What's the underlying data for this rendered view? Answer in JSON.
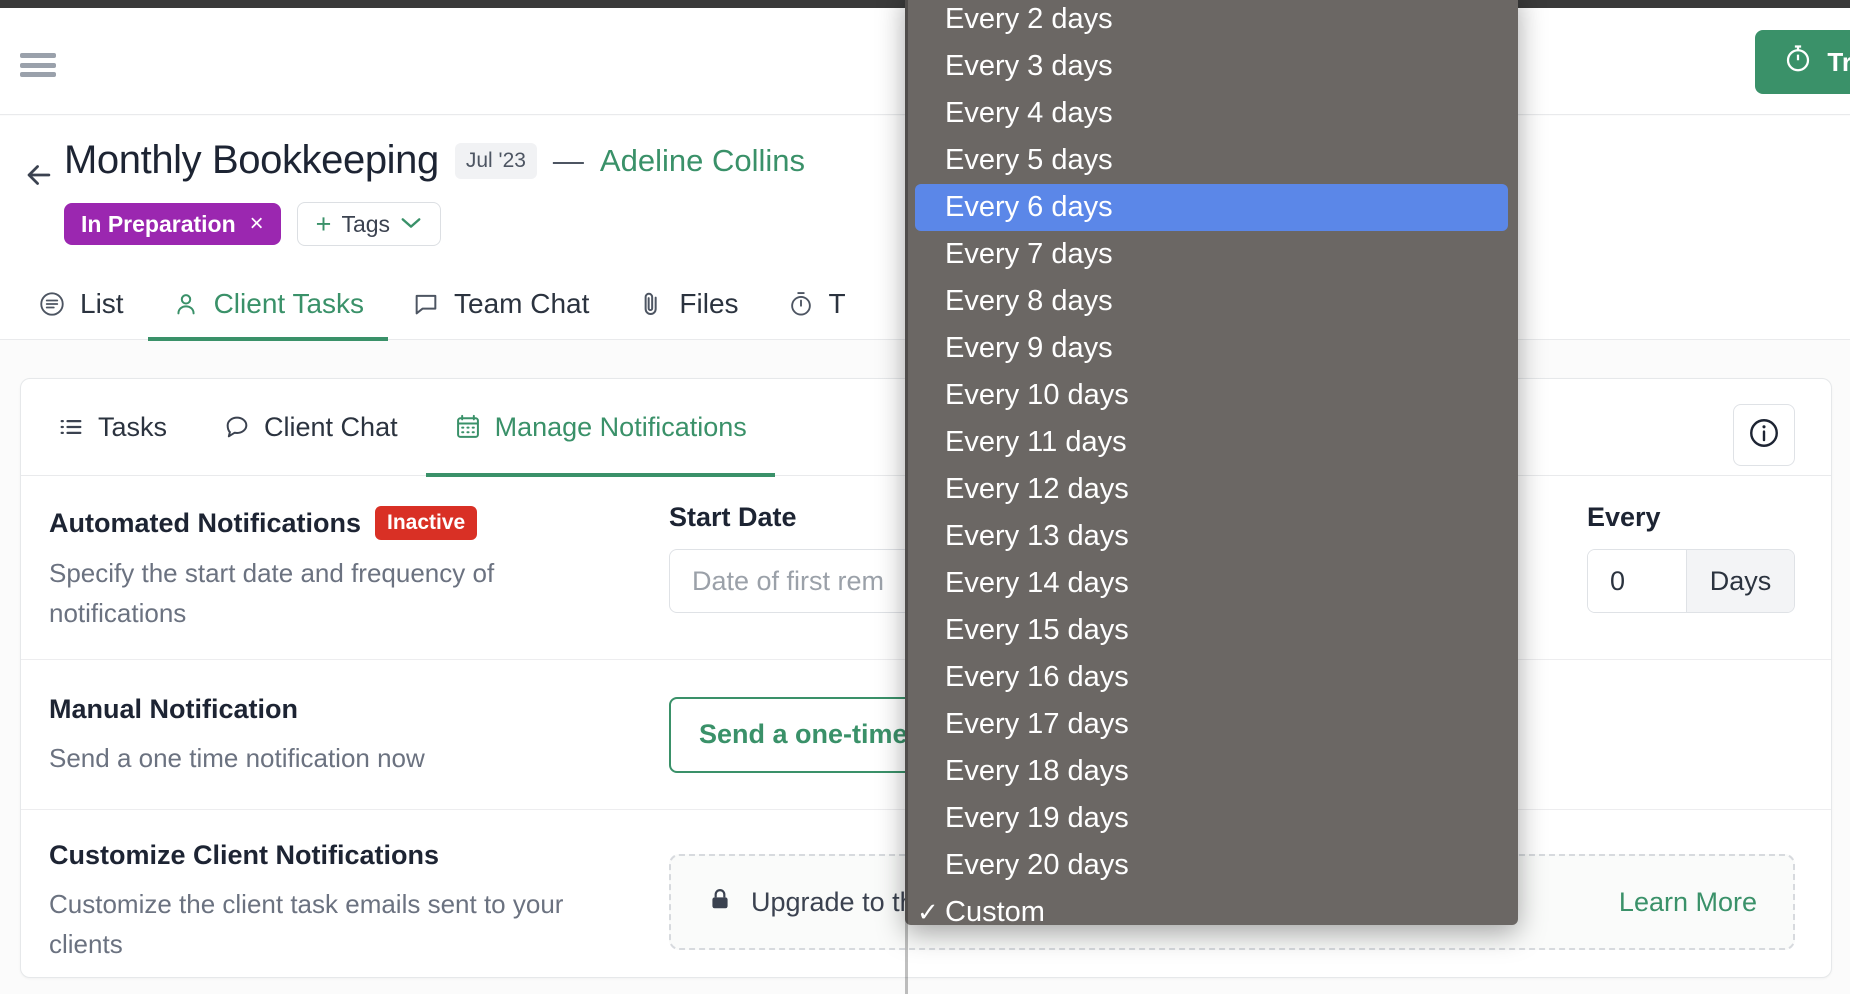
{
  "topbar": {
    "menu_icon": "hamburger-icon",
    "track_button": {
      "label": "Tr",
      "icon": "stopwatch-icon",
      "color": "#3a9169"
    }
  },
  "header": {
    "back_icon": "back-arrow-icon",
    "project_title": "Monthly Bookkeeping",
    "period": "Jul '23",
    "separator": "—",
    "client": "Adeline Collins",
    "status_tag": {
      "label": "In Preparation",
      "remove": "×",
      "color": "#9b27b0"
    },
    "tags_button": {
      "plus": "+",
      "label": "Tags",
      "chevron": "⌄"
    }
  },
  "main_tabs": [
    {
      "label": "List",
      "icon": "list-icon",
      "active": false
    },
    {
      "label": "Client Tasks",
      "icon": "person-icon",
      "active": true
    },
    {
      "label": "Team Chat",
      "icon": "chat-bubble-icon",
      "active": false
    },
    {
      "label": "Files",
      "icon": "paperclip-icon",
      "active": false
    },
    {
      "label": "T",
      "icon": "stopwatch-icon",
      "active": false
    }
  ],
  "card": {
    "tabs": [
      {
        "label": "Tasks",
        "icon": "list-lines-icon",
        "active": false
      },
      {
        "label": "Client Chat",
        "icon": "chat-bubble-icon",
        "active": false
      },
      {
        "label": "Manage Notifications",
        "icon": "calendar-icon",
        "active": true
      }
    ],
    "info_icon": "info-circle-icon",
    "rows": [
      {
        "title": "Automated Notifications",
        "badge": "Inactive",
        "badge_color": "#d93025",
        "subtitle": "Specify the start date and frequency of notifications",
        "start_date_label": "Start Date",
        "start_date_placeholder": "Date of first rem",
        "every_label": "Every",
        "every_value": "0",
        "every_unit": "Days"
      },
      {
        "title": "Manual Notification",
        "subtitle": "Send a one time notification now",
        "action_label": "Send a one-time n"
      },
      {
        "title": "Customize Client Notifications",
        "subtitle": "Customize the client task emails sent to your clients",
        "upgrade_icon": "lock-icon",
        "upgrade_label": "Upgrade to the",
        "learn_more": "Learn More"
      }
    ]
  },
  "dropdown": {
    "highlight_color": "#5b87e8",
    "background_color": "#6b6764",
    "selected_value": "Custom",
    "highlighted_value": "Every 6 days",
    "options": [
      {
        "label": "Every 2 days",
        "checked": false
      },
      {
        "label": "Every 3 days",
        "checked": false
      },
      {
        "label": "Every 4 days",
        "checked": false
      },
      {
        "label": "Every 5 days",
        "checked": false
      },
      {
        "label": "Every 6 days",
        "checked": false
      },
      {
        "label": "Every 7 days",
        "checked": false
      },
      {
        "label": "Every 8 days",
        "checked": false
      },
      {
        "label": "Every 9 days",
        "checked": false
      },
      {
        "label": "Every 10 days",
        "checked": false
      },
      {
        "label": "Every 11 days",
        "checked": false
      },
      {
        "label": "Every 12 days",
        "checked": false
      },
      {
        "label": "Every 13 days",
        "checked": false
      },
      {
        "label": "Every 14 days",
        "checked": false
      },
      {
        "label": "Every 15 days",
        "checked": false
      },
      {
        "label": "Every 16 days",
        "checked": false
      },
      {
        "label": "Every 17 days",
        "checked": false
      },
      {
        "label": "Every 18 days",
        "checked": false
      },
      {
        "label": "Every 19 days",
        "checked": false
      },
      {
        "label": "Every 20 days",
        "checked": false
      },
      {
        "label": "Custom",
        "checked": true
      }
    ]
  }
}
